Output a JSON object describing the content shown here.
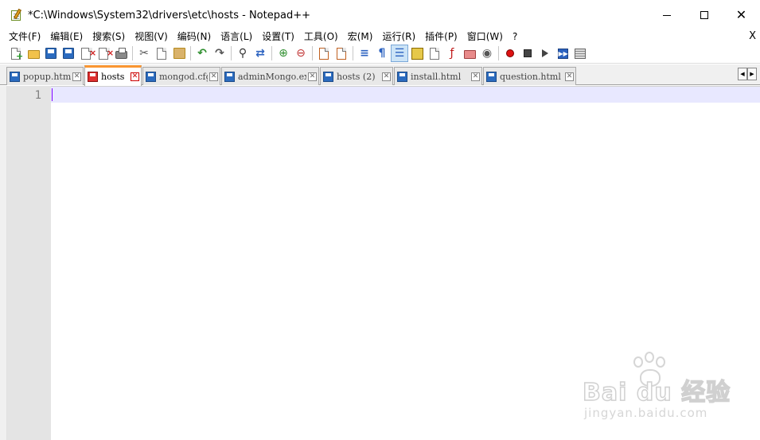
{
  "window": {
    "title": "*C:\\Windows\\System32\\drivers\\etc\\hosts - Notepad++",
    "icon": "notepad-plus-plus-icon",
    "controls": {
      "minimize_icon": "minimize-icon",
      "maximize_icon": "maximize-icon",
      "close_glyph": "✕"
    }
  },
  "menu": {
    "items": [
      "文件(F)",
      "编辑(E)",
      "搜索(S)",
      "视图(V)",
      "编码(N)",
      "语言(L)",
      "设置(T)",
      "工具(O)",
      "宏(M)",
      "运行(R)",
      "插件(P)",
      "窗口(W)",
      "?"
    ],
    "close_label": "X"
  },
  "toolbar": {
    "buttons": [
      "new-file-icon",
      "open-file-icon",
      "save-icon",
      "save-all-icon",
      "close-icon",
      "close-all-icon",
      "print-icon",
      "cut-icon",
      "copy-icon",
      "paste-icon",
      "undo-icon",
      "redo-icon",
      "find-icon",
      "replace-icon",
      "zoom-in-icon",
      "zoom-out-icon",
      "sync-vertical-icon",
      "sync-horizontal-icon",
      "word-wrap-icon",
      "show-all-characters-icon",
      "indent-guide-icon",
      "user-language-icon",
      "doc-map-icon",
      "function-list-icon",
      "folder-workspace-icon",
      "monitoring-icon",
      "record-macro-icon",
      "stop-recording-icon",
      "playback-macro-icon",
      "run-macro-multiple-icon",
      "save-macro-icon"
    ],
    "active_button": "indent-guide-icon"
  },
  "tabs": [
    {
      "label": "popup.html",
      "active": false
    },
    {
      "label": "hosts",
      "active": true
    },
    {
      "label": "mongod.cfg",
      "active": false
    },
    {
      "label": "adminMongo.exe",
      "active": false
    },
    {
      "label": "hosts (2)",
      "active": false
    },
    {
      "label": "install.html",
      "active": false
    },
    {
      "label": "question.html",
      "active": false
    }
  ],
  "tab_scroll": {
    "left": "◀",
    "right": "▶"
  },
  "editor": {
    "line_numbers": [
      "1"
    ],
    "content": "",
    "current_line_color": "#e8e8ff",
    "caret_color": "#8000ff"
  },
  "watermark": {
    "brand": "Bai du 经验",
    "url": "jingyan.baidu.com"
  },
  "colors": {
    "active_tab_accent": "#fa9632",
    "saved_tab_icon": "#2b6bbf",
    "unsaved_tab_icon": "#e03030"
  }
}
